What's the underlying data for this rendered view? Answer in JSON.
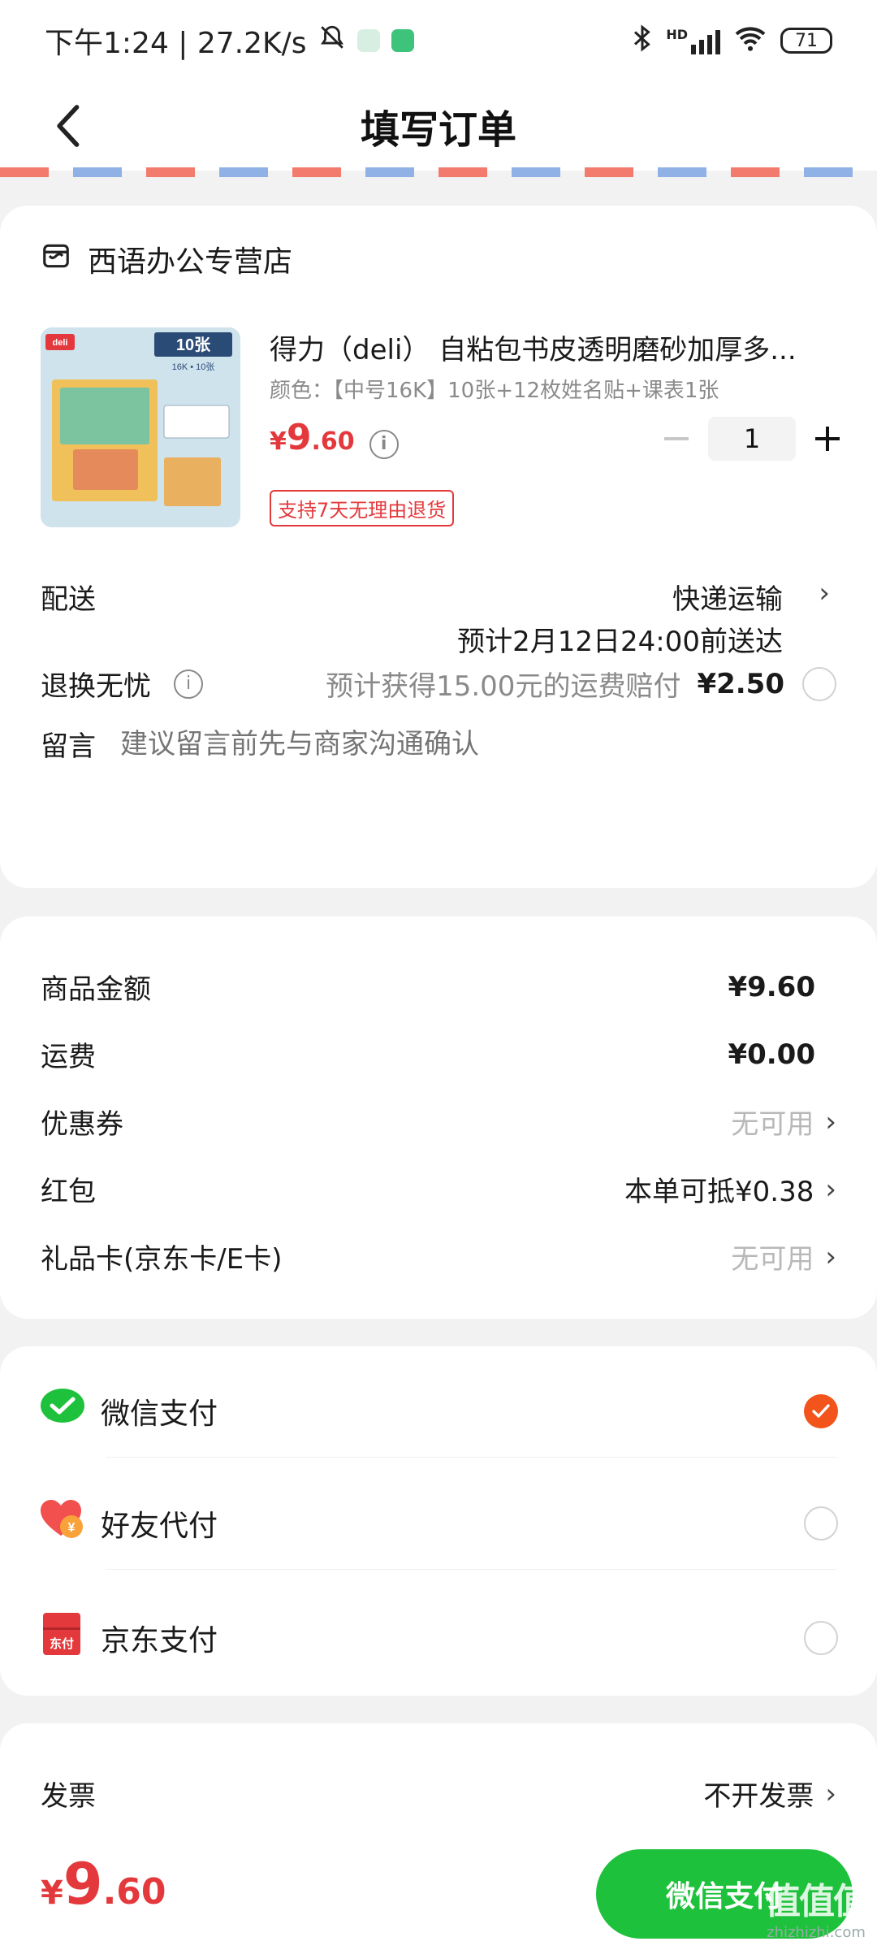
{
  "status_bar": {
    "time_speed": "下午1:24 | 27.2K/s",
    "battery": "71",
    "network_label": "HD"
  },
  "nav": {
    "title": "填写订单"
  },
  "store": {
    "name": "西语办公专营店"
  },
  "product": {
    "title": "得力（deli） 自粘包书皮透明磨砂加厚多...",
    "spec": "颜色：【中号16K】10张+12枚姓名贴+课表1张",
    "price_currency": "¥",
    "price_int": "9",
    "price_dec": ".60",
    "quantity": "1",
    "return_tag": "支持7天无理由退货",
    "thumb_text_count": "10张",
    "thumb_text_size": "16K • 10张",
    "thumb_text_brand": "deli"
  },
  "delivery": {
    "label": "配送",
    "method": "快递运输",
    "eta": "预计2月12日24:00前送达"
  },
  "return_worry_free": {
    "label": "退换无忧",
    "desc": "预计获得15.00元的运费赔付",
    "price": "¥2.50"
  },
  "message": {
    "label": "留言",
    "placeholder": "建议留言前先与商家沟通确认"
  },
  "amounts": {
    "goods_label": "商品金额",
    "goods_value": "¥9.60",
    "shipping_label": "运费",
    "shipping_value": "¥0.00",
    "coupon_label": "优惠券",
    "coupon_value": "无可用",
    "redpacket_label": "红包",
    "redpacket_value": "本单可抵¥0.38",
    "giftcard_label": "礼品卡(京东卡/E卡)",
    "giftcard_value": "无可用"
  },
  "payment": {
    "wechat": "微信支付",
    "friend": "好友代付",
    "jd": "京东支付",
    "selected": "wechat"
  },
  "invoice": {
    "label": "发票",
    "value": "不开发票"
  },
  "footer": {
    "currency": "¥",
    "total_int": "9",
    "total_dec": ".60",
    "pay_button": "微信支付"
  },
  "watermark": {
    "main": "值值值",
    "sub": "zhizhizhi.com"
  },
  "colors": {
    "price_red": "#e4393c",
    "wechat_green": "#1ec13b",
    "selected_orange": "#f2541b"
  }
}
